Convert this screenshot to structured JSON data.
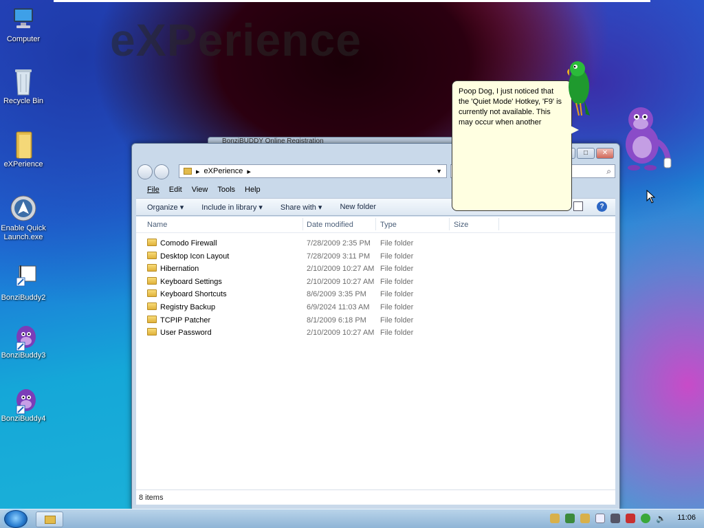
{
  "wallpaper": {
    "watermark": "eXPerience"
  },
  "desktop_icons": [
    {
      "id": "computer",
      "label": "Computer"
    },
    {
      "id": "recycle",
      "label": "Recycle Bin"
    },
    {
      "id": "experience",
      "label": "eXPerience"
    },
    {
      "id": "quicklaunch",
      "label": "Enable Quick Launch.exe"
    },
    {
      "id": "bonzi2",
      "label": "BonziBuddy2"
    },
    {
      "id": "bonzi3",
      "label": "BonziBuddy3"
    },
    {
      "id": "bonzi4",
      "label": "BonziBuddy4"
    }
  ],
  "window": {
    "background_title": "BonziBUDDY Online Registration",
    "address_path": "eXPerience",
    "menu": [
      "File",
      "Edit",
      "View",
      "Tools",
      "Help"
    ],
    "toolbar": {
      "organize": "Organize",
      "include": "Include in library",
      "share": "Share with",
      "newfolder": "New folder"
    },
    "columns": [
      "Name",
      "Date modified",
      "Type",
      "Size"
    ],
    "rows": [
      {
        "name": "Comodo Firewall",
        "date": "7/28/2009 2:35 PM",
        "type": "File folder"
      },
      {
        "name": "Desktop Icon Layout",
        "date": "7/28/2009 3:11 PM",
        "type": "File folder"
      },
      {
        "name": "Hibernation",
        "date": "2/10/2009 10:27 AM",
        "type": "File folder"
      },
      {
        "name": "Keyboard Settings",
        "date": "2/10/2009 10:27 AM",
        "type": "File folder"
      },
      {
        "name": "Keyboard Shortcuts",
        "date": "8/6/2009 3:35 PM",
        "type": "File folder"
      },
      {
        "name": "Registry Backup",
        "date": "6/9/2024 11:03 AM",
        "type": "File folder"
      },
      {
        "name": "TCPIP Patcher",
        "date": "8/1/2009 6:18 PM",
        "type": "File folder"
      },
      {
        "name": "User Password",
        "date": "2/10/2009 10:27 AM",
        "type": "File folder"
      }
    ],
    "status": "8 items"
  },
  "balloon": {
    "text": "Poop Dog, I just noticed that the 'Quiet Mode' Hotkey, 'F9' is currently not available. This may occur when another"
  },
  "taskbar": {
    "clock": "11:06"
  }
}
